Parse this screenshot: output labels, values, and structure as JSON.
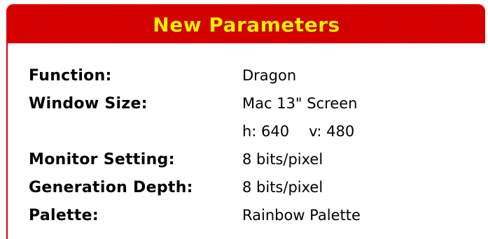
{
  "dialog": {
    "title": "New Parameters",
    "colors": {
      "title_bar": "#e60000",
      "title_text": "#ffea00",
      "border": "#e00000"
    }
  },
  "params": [
    {
      "label": "Function:",
      "value": "Dragon"
    },
    {
      "label": "Window Size:",
      "value": "Mac 13\" Screen"
    },
    {
      "label": "",
      "value_h": "h: 640",
      "value_v": "v: 480"
    },
    {
      "label": "Monitor Setting:",
      "value": "8 bits/pixel"
    },
    {
      "label": "Generation Depth:",
      "value": "8 bits/pixel"
    },
    {
      "label": "Palette:",
      "value": "Rainbow Palette"
    }
  ]
}
